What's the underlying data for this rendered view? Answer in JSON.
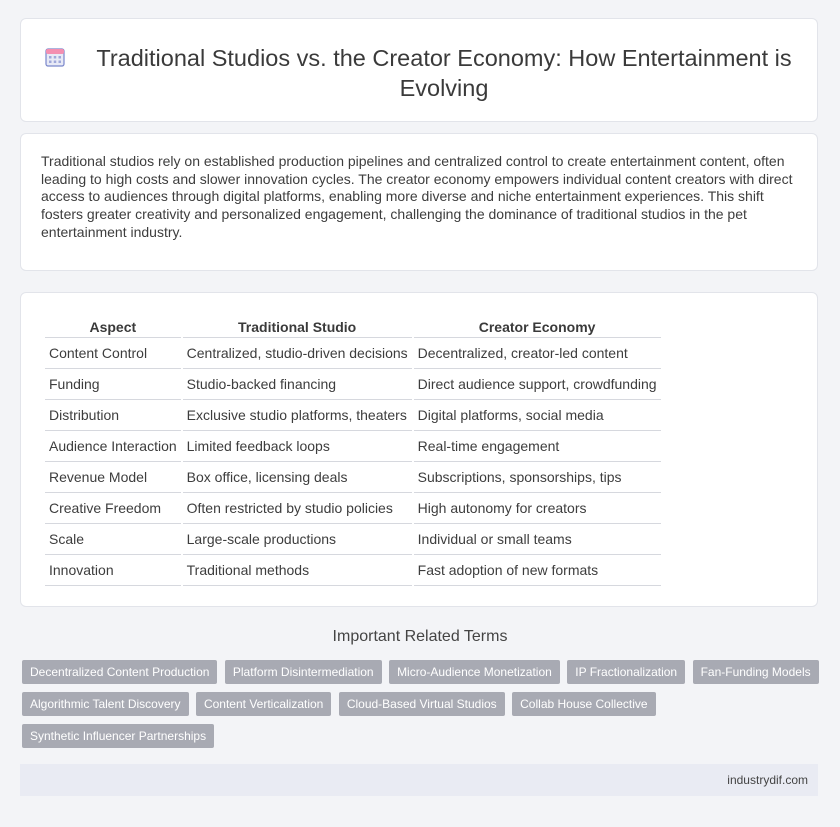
{
  "header": {
    "title": "Traditional Studios vs. the Creator Economy: How Entertainment is Evolving",
    "icon": "calendar-icon"
  },
  "intro": {
    "text": "Traditional studios rely on established production pipelines and centralized control to create entertainment content, often leading to high costs and slower innovation cycles. The creator economy empowers individual content creators with direct access to audiences through digital platforms, enabling more diverse and niche entertainment experiences. This shift fosters greater creativity and personalized engagement, challenging the dominance of traditional studios in the pet entertainment industry."
  },
  "table": {
    "headers": [
      "Aspect",
      "Traditional Studio",
      "Creator Economy"
    ],
    "rows": [
      [
        "Content Control",
        "Centralized, studio-driven decisions",
        "Decentralized, creator-led content"
      ],
      [
        "Funding",
        "Studio-backed financing",
        "Direct audience support, crowdfunding"
      ],
      [
        "Distribution",
        "Exclusive studio platforms, theaters",
        "Digital platforms, social media"
      ],
      [
        "Audience Interaction",
        "Limited feedback loops",
        "Real-time engagement"
      ],
      [
        "Revenue Model",
        "Box office, licensing deals",
        "Subscriptions, sponsorships, tips"
      ],
      [
        "Creative Freedom",
        "Often restricted by studio policies",
        "High autonomy for creators"
      ],
      [
        "Scale",
        "Large-scale productions",
        "Individual or small teams"
      ],
      [
        "Innovation",
        "Traditional methods",
        "Fast adoption of new formats"
      ]
    ]
  },
  "terms": {
    "title": "Important Related Terms",
    "items": [
      "Decentralized Content Production",
      "Platform Disintermediation",
      "Micro-Audience Monetization",
      "IP Fractionalization",
      "Fan-Funding Models",
      "Algorithmic Talent Discovery",
      "Content Verticalization",
      "Cloud-Based Virtual Studios",
      "Collab House Collective",
      "Synthetic Influencer Partnerships"
    ]
  },
  "footer": {
    "site": "industrydif.com"
  }
}
